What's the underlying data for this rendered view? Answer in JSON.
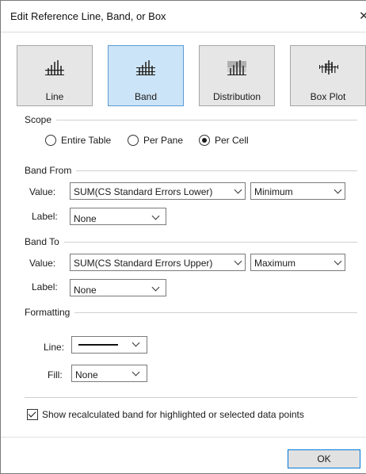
{
  "dialog": {
    "title": "Edit Reference Line, Band, or Box",
    "close_glyph": "✕"
  },
  "types": [
    {
      "label": "Line",
      "icon": "line-chart-icon",
      "selected": false
    },
    {
      "label": "Band",
      "icon": "band-chart-icon",
      "selected": true
    },
    {
      "label": "Distribution",
      "icon": "distribution-chart-icon",
      "selected": false
    },
    {
      "label": "Box Plot",
      "icon": "box-plot-icon",
      "selected": false
    }
  ],
  "scope": {
    "label": "Scope",
    "options": [
      {
        "label": "Entire Table",
        "checked": false
      },
      {
        "label": "Per Pane",
        "checked": false
      },
      {
        "label": "Per Cell",
        "checked": true
      }
    ]
  },
  "band_from": {
    "label": "Band From",
    "value_label": "Value:",
    "value": "SUM(CS Standard Errors Lower)",
    "aggregation": "Minimum",
    "label_label": "Label:",
    "label_value": "None"
  },
  "band_to": {
    "label": "Band To",
    "value_label": "Value:",
    "value": "SUM(CS Standard Errors Upper)",
    "aggregation": "Maximum",
    "label_label": "Label:",
    "label_value": "None"
  },
  "formatting": {
    "label": "Formatting",
    "line_label": "Line:",
    "fill_label": "Fill:",
    "fill_value": "None"
  },
  "recalc": {
    "label": "Show recalculated band for highlighted or selected data points",
    "checked": true
  },
  "ok_label": "OK",
  "colors": {
    "selected_bg": "#cce4f7",
    "selected_border": "#5b9bd5",
    "button_bg": "#e6e6e6",
    "focus_border": "#0078d7"
  }
}
